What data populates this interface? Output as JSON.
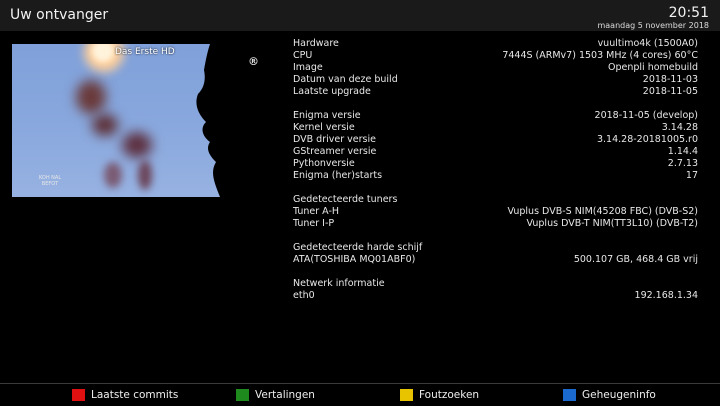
{
  "header": {
    "title": "Uw ontvanger",
    "time": "20:51",
    "date": "maandag  5 november 2018"
  },
  "video": {
    "channel": "Das Erste HD",
    "logo_glyph": "®",
    "watermark": "KOH NAL BEFOT"
  },
  "info": {
    "hardware": [
      {
        "label": "Hardware",
        "value": "vuultimo4k (1500A0)"
      },
      {
        "label": "CPU",
        "value": "7444S (ARMv7) 1503 MHz (4 cores) 60°C"
      },
      {
        "label": "Image",
        "value": "Openpli homebuild"
      },
      {
        "label": "Datum van deze build",
        "value": "2018-11-03"
      },
      {
        "label": "Laatste upgrade",
        "value": "2018-11-05"
      }
    ],
    "software": [
      {
        "label": "Enigma versie",
        "value": "2018-11-05 (develop)"
      },
      {
        "label": "Kernel versie",
        "value": "3.14.28"
      },
      {
        "label": "DVB driver versie",
        "value": "3.14.28-20181005.r0"
      },
      {
        "label": "GStreamer versie",
        "value": "1.14.4"
      },
      {
        "label": "Pythonversie",
        "value": "2.7.13"
      },
      {
        "label": "Enigma (her)starts",
        "value": "17"
      }
    ],
    "tuners_heading": "Gedetecteerde tuners",
    "tuners": [
      {
        "label": "Tuner A-H",
        "value": "Vuplus DVB-S NIM(45208 FBC) (DVB-S2)"
      },
      {
        "label": "Tuner I-P",
        "value": "Vuplus DVB-T NIM(TT3L10) (DVB-T2)"
      }
    ],
    "disk_heading": "Gedetecteerde harde schijf",
    "disks": [
      {
        "label": "ATA(TOSHIBA MQ01ABF0)",
        "value": "500.107 GB, 468.4 GB vrij"
      }
    ],
    "network_heading": "Netwerk informatie",
    "network": [
      {
        "label": "eth0",
        "value": "192.168.1.34"
      }
    ]
  },
  "footer": {
    "buttons": [
      {
        "label": "Laatste commits",
        "color": "#e01010"
      },
      {
        "label": "Vertalingen",
        "color": "#1e8a1e"
      },
      {
        "label": "Foutzoeken",
        "color": "#e8c400"
      },
      {
        "label": "Geheugeninfo",
        "color": "#1a6ad0"
      }
    ]
  }
}
